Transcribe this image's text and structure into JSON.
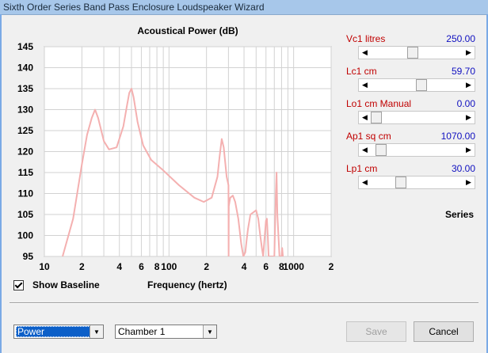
{
  "window": {
    "title": "Sixth Order Series Band Pass Enclosure Loudspeaker Wizard"
  },
  "chart_data": {
    "type": "line",
    "title": "Acoustical Power (dB)",
    "xlabel": "Frequency (hertz)",
    "ylabel": "",
    "x_scale": "log",
    "xlim": [
      10,
      2000
    ],
    "ylim": [
      95,
      145
    ],
    "y_ticks": [
      95,
      100,
      105,
      110,
      115,
      120,
      125,
      130,
      135,
      140,
      145
    ],
    "x_tick_labels": [
      "10",
      "2",
      "4",
      "6",
      "8",
      "100",
      "2",
      "4",
      "6",
      "8",
      "1000",
      "2"
    ],
    "grid": true,
    "series": [
      {
        "color": "#f4b0b0",
        "x": [
          14,
          17,
          20,
          22,
          24,
          25.5,
          27,
          30,
          33,
          38,
          43,
          46,
          48,
          50,
          52,
          56,
          62,
          72,
          90,
          120,
          160,
          190,
          220,
          245,
          255,
          265,
          275,
          290,
          300,
          301,
          302,
          310,
          325,
          340,
          360,
          380,
          395,
          410,
          420,
          430,
          450,
          500,
          520,
          540,
          560,
          570,
          580,
          600,
          610,
          620,
          630,
          700,
          720,
          730,
          740,
          770,
          800,
          810,
          820
        ],
        "y": [
          95,
          104,
          117,
          124,
          128,
          130,
          128,
          122.5,
          120.5,
          121,
          126,
          131,
          134,
          135,
          133,
          127,
          121.5,
          118,
          115.5,
          112,
          109,
          108,
          109,
          114,
          119,
          123,
          121,
          114,
          112,
          95,
          107,
          109,
          109.5,
          108,
          104,
          98,
          95,
          96,
          99,
          101.5,
          105,
          106,
          104,
          100,
          96.5,
          95,
          98,
          103.5,
          104,
          100,
          95,
          95,
          110,
          115,
          105,
          95,
          95,
          97,
          95
        ]
      }
    ]
  },
  "baseline": {
    "label": "Show Baseline",
    "checked": true
  },
  "params": [
    {
      "name": "Vc1  litres",
      "value": "250.00",
      "position": 0.45
    },
    {
      "name": "Lc1  cm",
      "value": "59.70",
      "position": 0.56
    },
    {
      "name": "Lo1  cm  Manual",
      "value": "0.00",
      "position": 0.0
    },
    {
      "name": "Ap1  sq cm",
      "value": "1070.00",
      "position": 0.06
    },
    {
      "name": "Lp1  cm",
      "value": "30.00",
      "position": 0.3
    }
  ],
  "series_label": "Series",
  "footer": {
    "mode_select": "Power",
    "chamber_select": "Chamber 1",
    "save_label": "Save",
    "cancel_label": "Cancel"
  },
  "icons": {
    "left_arrow": "◀",
    "right_arrow": "▶",
    "dropdown": "▼"
  }
}
